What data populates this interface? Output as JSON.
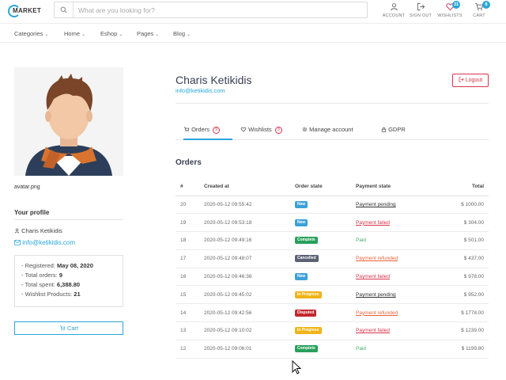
{
  "header": {
    "logo_text": "MARKET",
    "search_placeholder": "What are you looking for?",
    "icons": [
      {
        "label": "ACCOUNT",
        "icon": "user-icon"
      },
      {
        "label": "SIGN OUT",
        "icon": "sign-out-icon"
      },
      {
        "label": "WISHLISTS",
        "icon": "heart-icon",
        "badge": "31"
      },
      {
        "label": "CART",
        "icon": "cart-icon",
        "badge": "8"
      }
    ]
  },
  "nav": [
    "Categories",
    "Home",
    "Eshop",
    "Pages",
    "Blog"
  ],
  "sidebar": {
    "avatar_caption": "avatar.png",
    "profile_title": "Your profile",
    "name": "Charis Ketikidis",
    "email": "info@ketikidis.com",
    "stats": [
      {
        "label": "- Registered:",
        "value": "May 08, 2020"
      },
      {
        "label": "- Total orders:",
        "value": "9"
      },
      {
        "label": "- Total spent:",
        "value": "6,388.80"
      },
      {
        "label": "- Wishlist Products:",
        "value": "21"
      }
    ],
    "cart_button": "Cart"
  },
  "profile": {
    "name": "Charis Ketikidis",
    "email": "info@ketikidis.com",
    "logout": "Logout"
  },
  "tabs": [
    {
      "label": "Orders",
      "count": "9",
      "icon": "cart-icon"
    },
    {
      "label": "Wishlists",
      "count": "3",
      "icon": "heart-icon"
    },
    {
      "label": "Manage account",
      "icon": "gear-icon"
    },
    {
      "label": "GDPR",
      "icon": "lock-icon"
    }
  ],
  "orders": {
    "title": "Orders",
    "columns": [
      "#",
      "Created at",
      "Order state",
      "Payment state",
      "Total"
    ],
    "rows": [
      {
        "id": "20",
        "created": "2020-05-12 09:55:42",
        "state": "New",
        "payment": "Payment pending",
        "total": "$ 1000.00"
      },
      {
        "id": "19",
        "created": "2020-05-12 09:53:18",
        "state": "New",
        "payment": "Payment failed",
        "total": "$ 304.00"
      },
      {
        "id": "18",
        "created": "2020-05-12 09:49:16",
        "state": "Complete",
        "payment": "Paid",
        "total": "$ 501.00"
      },
      {
        "id": "17",
        "created": "2020-05-12 09:48:07",
        "state": "Cancelled",
        "payment": "Payment refunded",
        "total": "$ 437.00"
      },
      {
        "id": "16",
        "created": "2020-05-12 09:46:36",
        "state": "New",
        "payment": "Payment failed",
        "total": "$ 978.00"
      },
      {
        "id": "15",
        "created": "2020-05-12 09:45:02",
        "state": "In Progress",
        "payment": "Payment pending",
        "total": "$ 952.00"
      },
      {
        "id": "14",
        "created": "2020-05-12 09:42:56",
        "state": "Disputed",
        "payment": "Payment refunded",
        "total": "$ 1778.00"
      },
      {
        "id": "13",
        "created": "2020-05-12 09:10:02",
        "state": "In Progress",
        "payment": "Payment failed",
        "total": "$ 1239.00"
      },
      {
        "id": "12",
        "created": "2020-05-12 09:06:01",
        "state": "Complete",
        "payment": "Paid",
        "total": "$ 1199.80"
      }
    ]
  },
  "colors": {
    "accent": "#2aa6d9",
    "danger": "#d8354c",
    "state_new": "#3ba1d8",
    "state_complete": "#27a05a",
    "state_cancelled": "#5a6273",
    "state_in_progress": "#f0b418",
    "state_disputed": "#c4262e"
  }
}
